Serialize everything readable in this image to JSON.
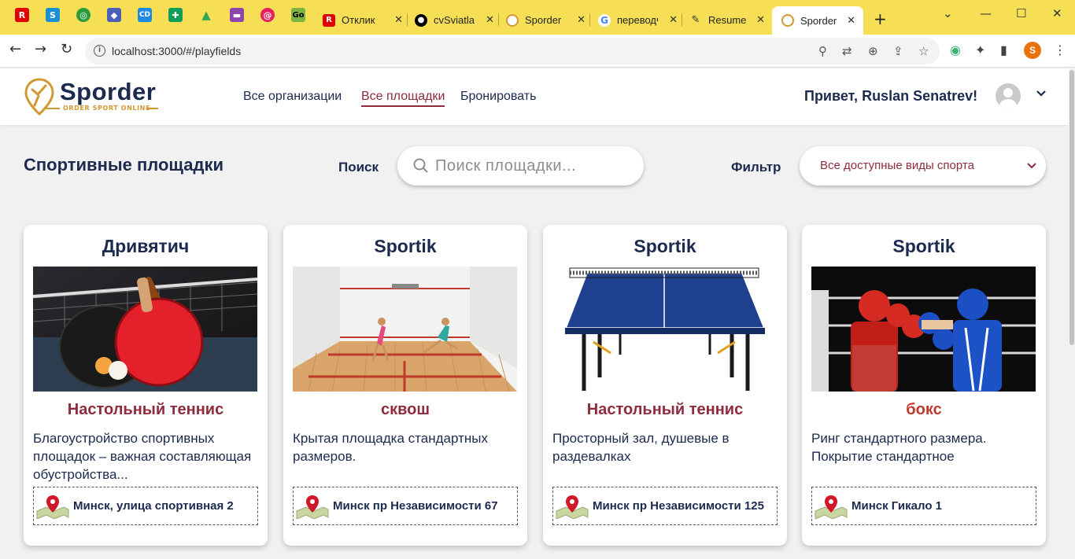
{
  "browser": {
    "tabs": [
      {
        "label": "Отклик",
        "icon": "r-icon",
        "color": "#e00000"
      },
      {
        "label": "cvSviatlana",
        "icon": "github-icon",
        "color": "#000000"
      },
      {
        "label": "Sporder",
        "icon": "sporder-icon",
        "color": "#d29833"
      },
      {
        "label": "переводчик",
        "icon": "google-icon",
        "color": "#4285f4"
      },
      {
        "label": "Resume",
        "icon": "resume-icon",
        "color": "#333333"
      },
      {
        "label": "Sporder",
        "icon": "sporder-icon",
        "color": "#d29833",
        "active": true
      }
    ],
    "address": "localhost:3000/#/playfields",
    "profile_initial": "S"
  },
  "site": {
    "brand": "Sporder",
    "slogan": "ORDER SPORT ONLINE",
    "nav": [
      "Все организации",
      "Все площадки",
      "Бронировать"
    ],
    "active_nav": "Все площадки",
    "greeting": "Привет, Ruslan Senatrev!"
  },
  "toolbar": {
    "title": "Спортивные площадки",
    "search_label": "Поиск",
    "search_placeholder": "Поиск площадки...",
    "filter_label": "Фильтр",
    "filter_value": "Все доступные виды спорта"
  },
  "cards": [
    {
      "org": "Дривятич",
      "sport": "Настольный теннис",
      "description": "Благоустройство спортивных площадок – важная составляющая обустройства...",
      "address": "Минск, улица спортивная 2"
    },
    {
      "org": "Sportik",
      "sport": "сквош",
      "description": "Крытая площадка стандартных размеров.",
      "address": "Минск пр Независимости 67"
    },
    {
      "org": "Sportik",
      "sport": "Настольный теннис",
      "description": "Просторный зал, душевые в раздевалках",
      "address": "Минск пр Независимости 125"
    },
    {
      "org": "Sportik",
      "sport": "бокс",
      "description": "Ринг стандартного размера. Покрытие стандартное",
      "address": "Минск Гикало 1"
    }
  ],
  "colors": {
    "brand_navy": "#1b2a4e",
    "accent": "#8e2b3c",
    "gold": "#d29833",
    "tab_bar": "#f7df55"
  }
}
